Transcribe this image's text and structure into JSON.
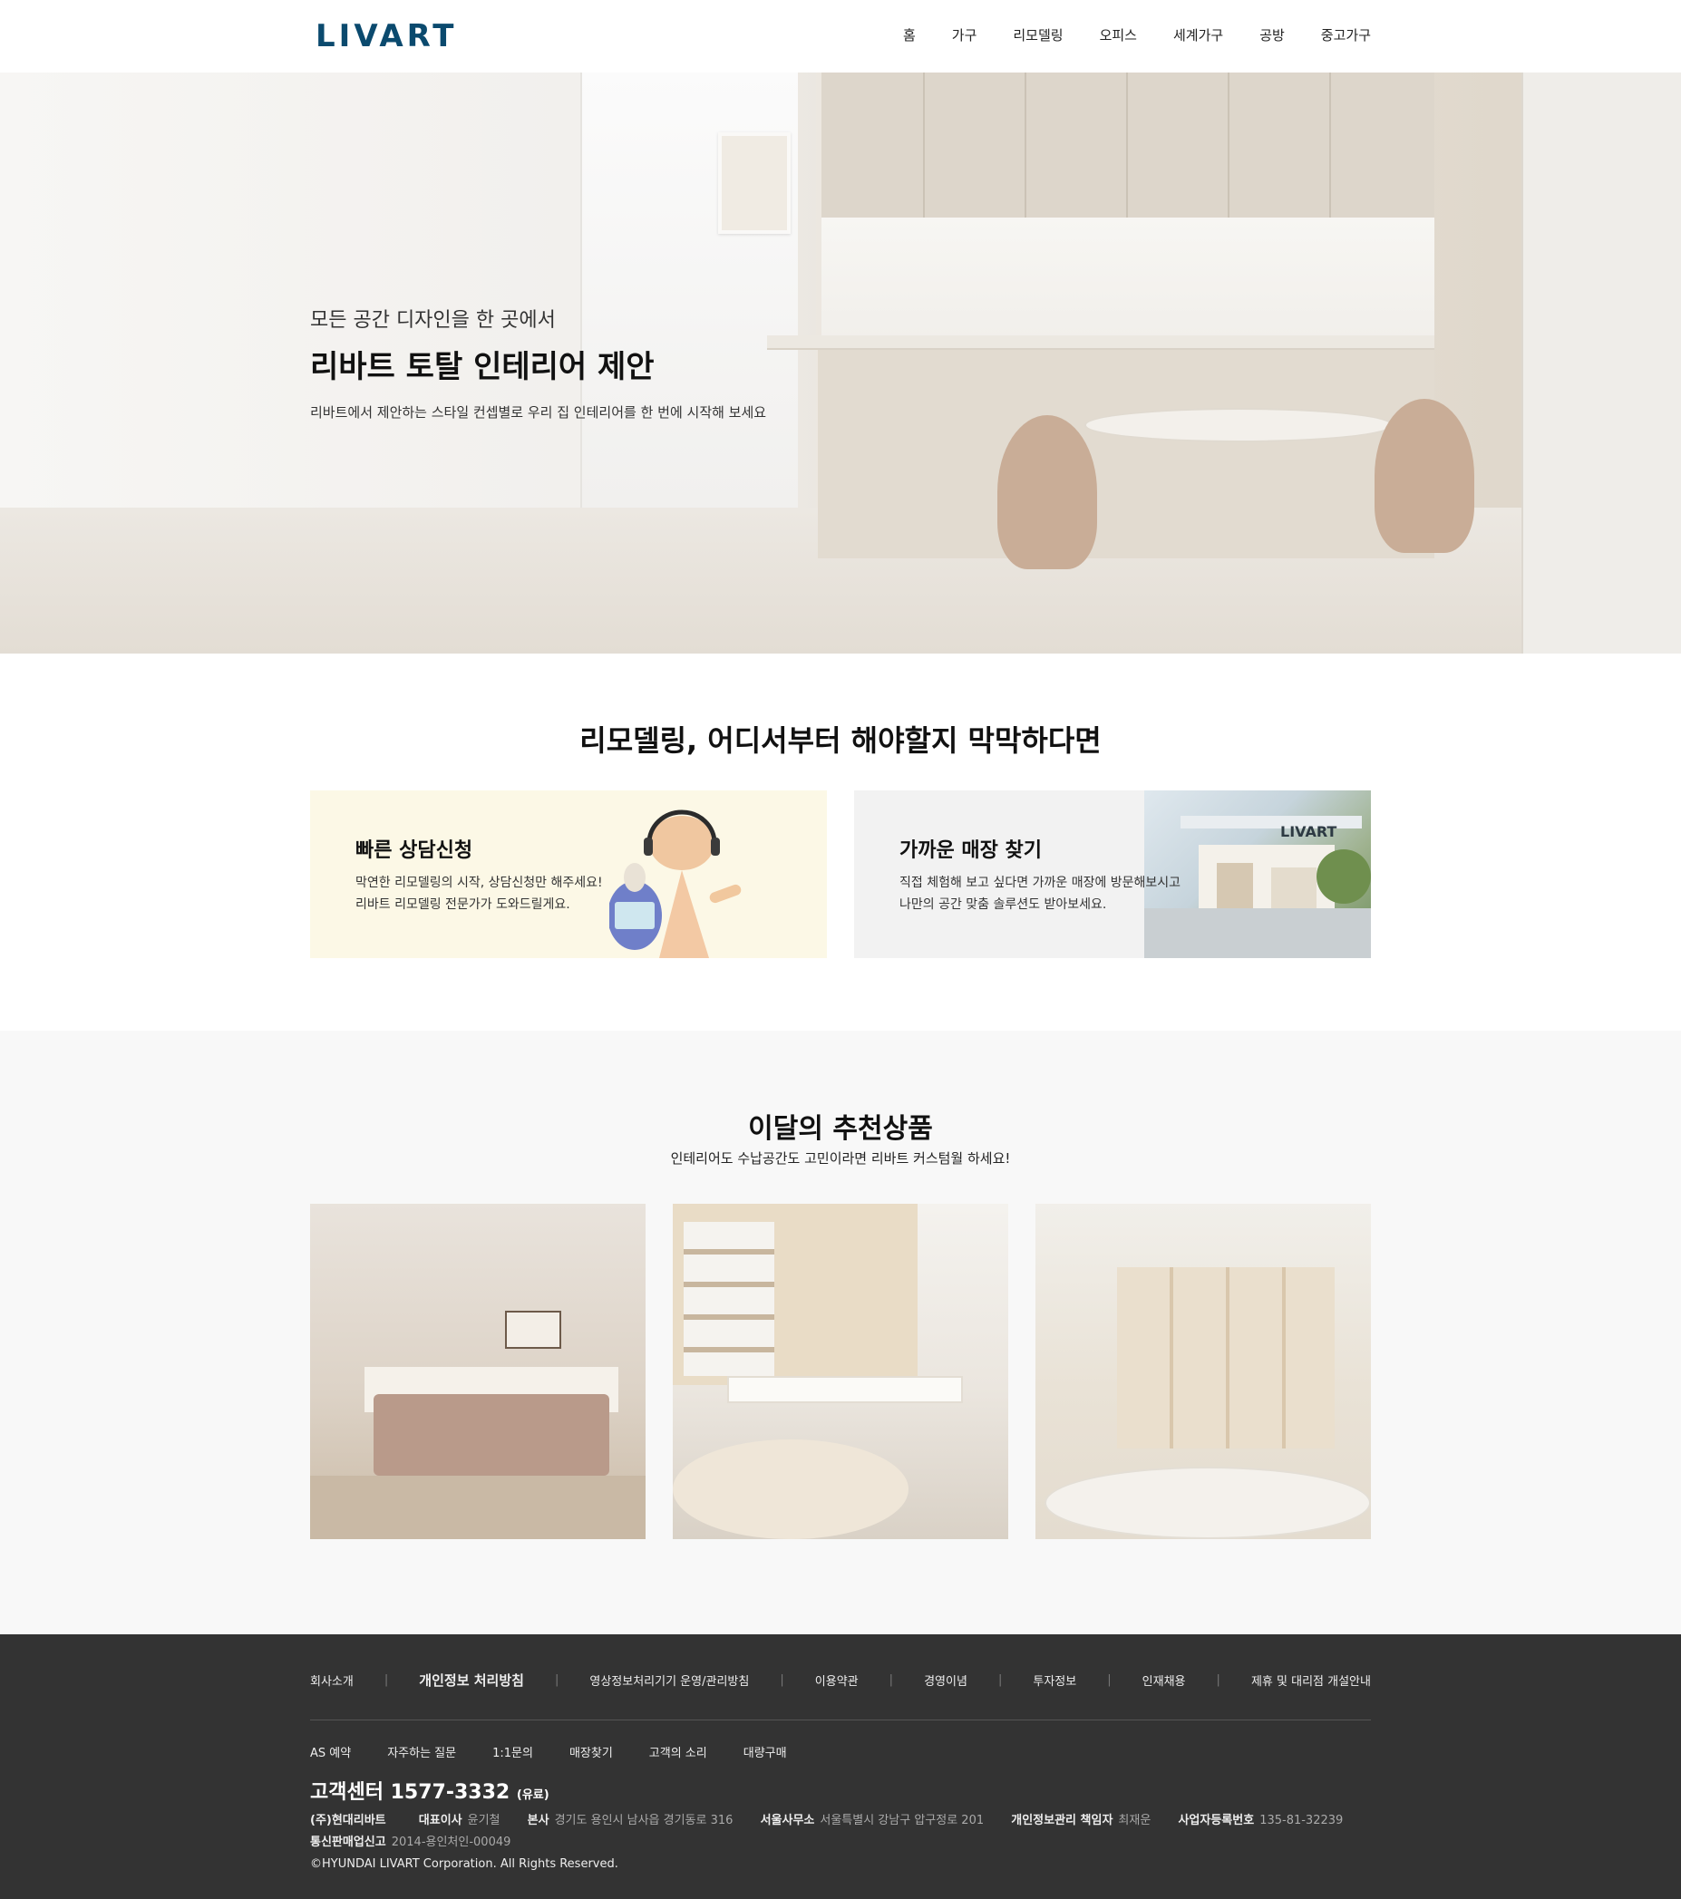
{
  "header": {
    "logo": "LIVART",
    "nav": [
      "홈",
      "가구",
      "리모델링",
      "오피스",
      "세계가구",
      "공방",
      "중고가구"
    ]
  },
  "hero": {
    "subtitle": "모든 공간 디자인을 한 곳에서",
    "title": "리바트 토탈 인테리어 제안",
    "description": "리바트에서 제안하는 스타일 컨셉별로 우리 집 인테리어를 한 번에 시작해 보세요",
    "slide_count": 4,
    "active_slide": 3
  },
  "remodel": {
    "title": "리모델링, 어디서부터 해야할지 막막하다면",
    "cards": [
      {
        "title": "빠른 상담신청",
        "line1": "막연한 리모델링의 시작, 상담신청만 해주세요!",
        "line2": "리바트 리모델링 전문가가 도와드릴게요."
      },
      {
        "title": "가까운 매장 찾기",
        "line1": "직접 체험해 보고 싶다면 가까운 매장에 방문해보시고",
        "line2": "나만의 공간 맞춤 솔루션도 받아보세요.",
        "sign": "LIVART"
      }
    ]
  },
  "recommend": {
    "title": "이달의 추천상품",
    "subtitle": "인테리어도 수납공간도 고민이라면 리바트 커스텀월 하세요!"
  },
  "footer": {
    "nav1": [
      "회사소개",
      "개인정보 처리방침",
      "영상정보처리기기 운영/관리방침",
      "이용약관",
      "경영이념",
      "투자정보",
      "인재채용",
      "제휴 및 대리점 개설안내"
    ],
    "nav2": [
      "AS 예약",
      "자주하는 질문",
      "1:1문의",
      "매장찾기",
      "고객의 소리",
      "대량구매"
    ],
    "cs_label": "고객센터 1577-3332",
    "cs_note": "(유료)",
    "company": "(주)현대리바트",
    "ceo_label": "대표이사",
    "ceo": "윤기철",
    "hq_label": "본사",
    "hq": "경기도 용인시 남사읍 경기동로 316",
    "seoul_label": "서울사무소",
    "seoul": "서울특별시 강남구 압구정로 201",
    "privacy_label": "개인정보관리 책임자",
    "privacy": "최재운",
    "biz_label": "사업자등록번호",
    "biz": "135-81-32239",
    "telecom_label": "통신판매업신고",
    "telecom": "2014-용인처인-00049",
    "copyright": "©HYUNDAI LIVART Corporation. All Rights Reserved."
  },
  "colors": {
    "brand": "#0b4a6e",
    "footer_bg": "#333333",
    "section_bg": "#f8f8f8",
    "accent": "#d7c3a0"
  }
}
